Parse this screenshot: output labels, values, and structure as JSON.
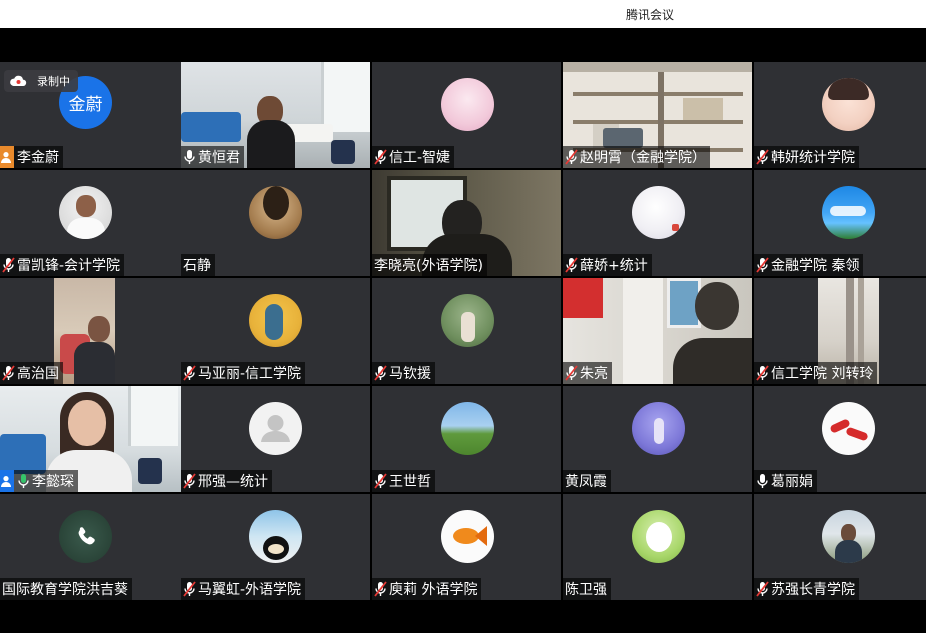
{
  "app": {
    "title": "腾讯会议"
  },
  "recording": {
    "label": "录制中"
  },
  "participants": [
    {
      "name": "李金蔚",
      "avatar_text": "金蔚",
      "host": true
    },
    {
      "name": "黄恒君",
      "mic": "on"
    },
    {
      "name": "信工-智婕",
      "mic": "muted"
    },
    {
      "name": "赵明霄（金融学院）",
      "mic": "muted"
    },
    {
      "name": "韩妍统计学院",
      "mic": "muted"
    },
    {
      "name": "雷凯锋-会计学院",
      "mic": "muted"
    },
    {
      "name": "石静"
    },
    {
      "name": "李晓亮(外语学院)"
    },
    {
      "name": "薛娇+统计",
      "mic": "muted"
    },
    {
      "name": "金融学院 秦领",
      "mic": "muted"
    },
    {
      "name": "高治国",
      "mic": "muted"
    },
    {
      "name": "马亚丽-信工学院",
      "mic": "muted"
    },
    {
      "name": "马钦援",
      "mic": "muted"
    },
    {
      "name": "朱亮",
      "mic": "muted"
    },
    {
      "name": "信工学院 刘转玲",
      "mic": "muted"
    },
    {
      "name": "李懿琛",
      "mic": "on",
      "speaking": true,
      "cohost": true
    },
    {
      "name": "邢强—统计",
      "mic": "muted"
    },
    {
      "name": "王世哲",
      "mic": "muted"
    },
    {
      "name": "黄凤霞"
    },
    {
      "name": "葛丽娟",
      "mic": "on"
    },
    {
      "name": "国际教育学院洪吉葵"
    },
    {
      "name": "马翼虹-外语学院",
      "mic": "muted"
    },
    {
      "name": "庾莉 外语学院",
      "mic": "muted"
    },
    {
      "name": "陈卫强"
    },
    {
      "name": "苏强长青学院",
      "mic": "muted"
    }
  ]
}
